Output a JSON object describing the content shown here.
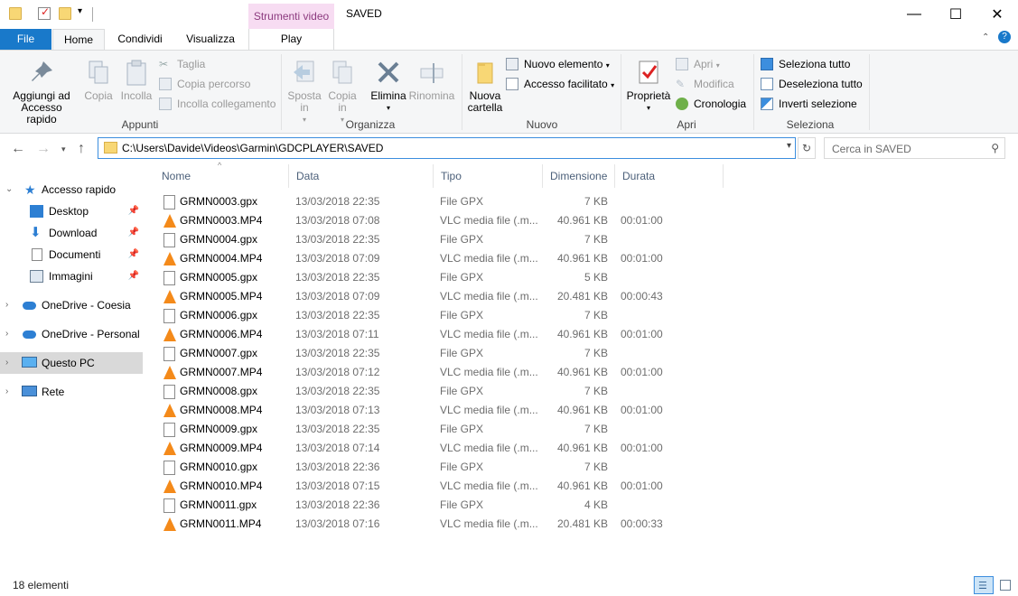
{
  "title_bar": {
    "context_tab": "Strumenti video",
    "title": "SAVED",
    "minimize": "—",
    "maximize": "☐",
    "close": "✕"
  },
  "tabs": {
    "file": "File",
    "home": "Home",
    "condividi": "Condividi",
    "visualizza": "Visualizza",
    "play": "Play"
  },
  "ribbon": {
    "pin": "Aggiungi ad Accesso rapido",
    "copia": "Copia",
    "incolla": "Incolla",
    "taglia": "Taglia",
    "copia_percorso": "Copia percorso",
    "incolla_collegamento": "Incolla collegamento",
    "group_appunti": "Appunti",
    "sposta_in": "Sposta in",
    "copia_in": "Copia in",
    "elimina": "Elimina",
    "rinomina": "Rinomina",
    "group_organizza": "Organizza",
    "nuova_cartella": "Nuova cartella",
    "nuovo_elemento": "Nuovo elemento",
    "accesso_facilitato": "Accesso facilitato",
    "group_nuovo": "Nuovo",
    "proprieta": "Proprietà",
    "apri": "Apri",
    "modifica": "Modifica",
    "cronologia": "Cronologia",
    "group_apri": "Apri",
    "seleziona_tutto": "Seleziona tutto",
    "deseleziona_tutto": "Deseleziona tutto",
    "inverti_selezione": "Inverti selezione",
    "group_seleziona": "Seleziona"
  },
  "address": {
    "path": "C:\\Users\\Davide\\Videos\\Garmin\\GDCPLAYER\\SAVED",
    "search_placeholder": "Cerca in SAVED"
  },
  "nav": {
    "accesso_rapido": "Accesso rapido",
    "desktop": "Desktop",
    "download": "Download",
    "documenti": "Documenti",
    "immagini": "Immagini",
    "onedrive_coesia": "OneDrive - Coesia",
    "onedrive_personal": "OneDrive - Personal",
    "questo_pc": "Questo PC",
    "rete": "Rete"
  },
  "columns": {
    "nome": "Nome",
    "data": "Data",
    "tipo": "Tipo",
    "dimensione": "Dimensione",
    "durata": "Durata"
  },
  "files": [
    {
      "name": "GRMN0003.gpx",
      "date": "13/03/2018 22:35",
      "type": "File GPX",
      "size": "7 KB",
      "duration": "",
      "icon": "gpx-file-icon"
    },
    {
      "name": "GRMN0003.MP4",
      "date": "13/03/2018 07:08",
      "type": "VLC media file (.m...",
      "size": "40.961 KB",
      "duration": "00:01:00",
      "icon": "vlc-icon"
    },
    {
      "name": "GRMN0004.gpx",
      "date": "13/03/2018 22:35",
      "type": "File GPX",
      "size": "7 KB",
      "duration": "",
      "icon": "gpx-file-icon"
    },
    {
      "name": "GRMN0004.MP4",
      "date": "13/03/2018 07:09",
      "type": "VLC media file (.m...",
      "size": "40.961 KB",
      "duration": "00:01:00",
      "icon": "vlc-icon"
    },
    {
      "name": "GRMN0005.gpx",
      "date": "13/03/2018 22:35",
      "type": "File GPX",
      "size": "5 KB",
      "duration": "",
      "icon": "gpx-file-icon"
    },
    {
      "name": "GRMN0005.MP4",
      "date": "13/03/2018 07:09",
      "type": "VLC media file (.m...",
      "size": "20.481 KB",
      "duration": "00:00:43",
      "icon": "vlc-icon"
    },
    {
      "name": "GRMN0006.gpx",
      "date": "13/03/2018 22:35",
      "type": "File GPX",
      "size": "7 KB",
      "duration": "",
      "icon": "gpx-file-icon"
    },
    {
      "name": "GRMN0006.MP4",
      "date": "13/03/2018 07:11",
      "type": "VLC media file (.m...",
      "size": "40.961 KB",
      "duration": "00:01:00",
      "icon": "vlc-icon"
    },
    {
      "name": "GRMN0007.gpx",
      "date": "13/03/2018 22:35",
      "type": "File GPX",
      "size": "7 KB",
      "duration": "",
      "icon": "gpx-file-icon"
    },
    {
      "name": "GRMN0007.MP4",
      "date": "13/03/2018 07:12",
      "type": "VLC media file (.m...",
      "size": "40.961 KB",
      "duration": "00:01:00",
      "icon": "vlc-icon"
    },
    {
      "name": "GRMN0008.gpx",
      "date": "13/03/2018 22:35",
      "type": "File GPX",
      "size": "7 KB",
      "duration": "",
      "icon": "gpx-file-icon"
    },
    {
      "name": "GRMN0008.MP4",
      "date": "13/03/2018 07:13",
      "type": "VLC media file (.m...",
      "size": "40.961 KB",
      "duration": "00:01:00",
      "icon": "vlc-icon"
    },
    {
      "name": "GRMN0009.gpx",
      "date": "13/03/2018 22:35",
      "type": "File GPX",
      "size": "7 KB",
      "duration": "",
      "icon": "gpx-file-icon"
    },
    {
      "name": "GRMN0009.MP4",
      "date": "13/03/2018 07:14",
      "type": "VLC media file (.m...",
      "size": "40.961 KB",
      "duration": "00:01:00",
      "icon": "vlc-icon"
    },
    {
      "name": "GRMN0010.gpx",
      "date": "13/03/2018 22:36",
      "type": "File GPX",
      "size": "7 KB",
      "duration": "",
      "icon": "gpx-file-icon"
    },
    {
      "name": "GRMN0010.MP4",
      "date": "13/03/2018 07:15",
      "type": "VLC media file (.m...",
      "size": "40.961 KB",
      "duration": "00:01:00",
      "icon": "vlc-icon"
    },
    {
      "name": "GRMN0011.gpx",
      "date": "13/03/2018 22:36",
      "type": "File GPX",
      "size": "4 KB",
      "duration": "",
      "icon": "gpx-file-icon"
    },
    {
      "name": "GRMN0011.MP4",
      "date": "13/03/2018 07:16",
      "type": "VLC media file (.m...",
      "size": "20.481 KB",
      "duration": "00:00:33",
      "icon": "vlc-icon"
    }
  ],
  "status": {
    "count": "18 elementi"
  },
  "colors": {
    "accent": "#1979ca",
    "context_tab": "#f7dcf2",
    "vlc_orange": "#f48a1a",
    "folder_yellow": "#f8d775"
  }
}
